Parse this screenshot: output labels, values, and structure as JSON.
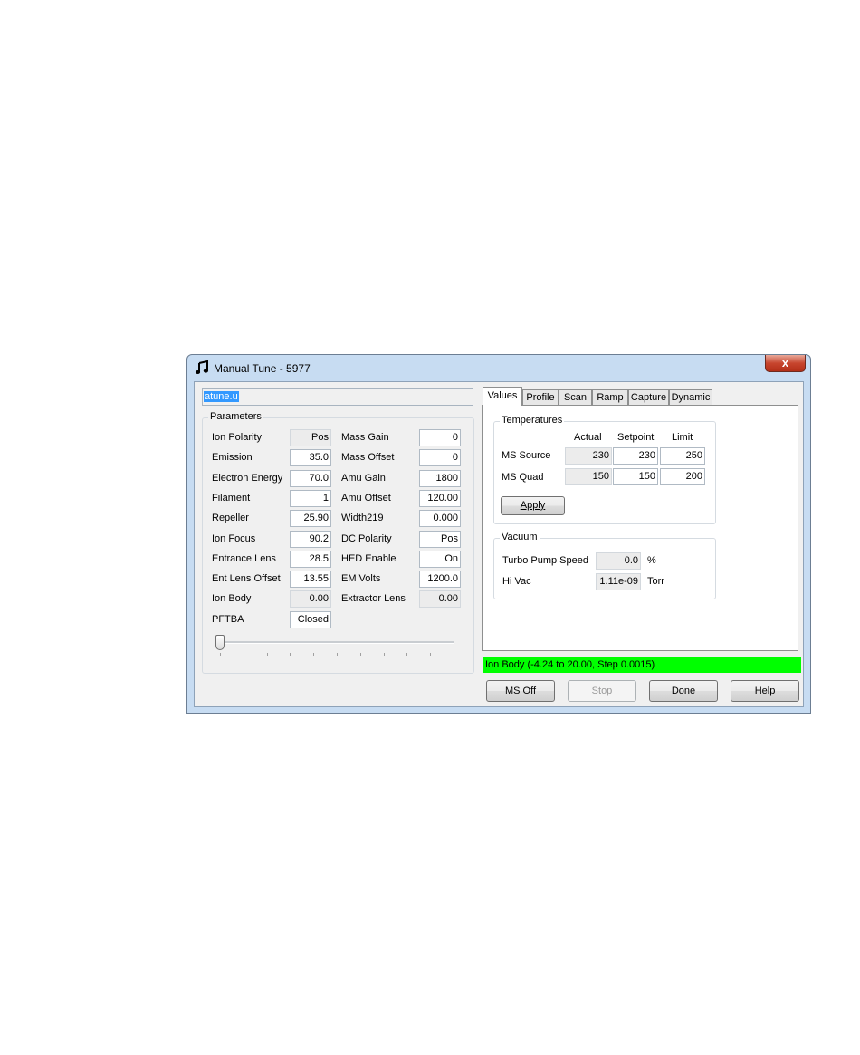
{
  "window": {
    "title": "Manual Tune - 5977",
    "close_glyph": "x"
  },
  "file_name": "atune.u",
  "parameters": {
    "title": "Parameters",
    "left": [
      {
        "label": "Ion Polarity",
        "value": "Pos",
        "readonly": true
      },
      {
        "label": "Emission",
        "value": "35.0",
        "readonly": false
      },
      {
        "label": "Electron Energy",
        "value": "70.0",
        "readonly": false
      },
      {
        "label": "Filament",
        "value": "1",
        "readonly": false
      },
      {
        "label": "Repeller",
        "value": "25.90",
        "readonly": false
      },
      {
        "label": "Ion Focus",
        "value": "90.2",
        "readonly": false
      },
      {
        "label": "Entrance Lens",
        "value": "28.5",
        "readonly": false
      },
      {
        "label": "Ent Lens Offset",
        "value": "13.55",
        "readonly": false
      },
      {
        "label": "Ion Body",
        "value": "0.00",
        "readonly": true
      },
      {
        "label": "PFTBA",
        "value": "Closed",
        "readonly": false
      }
    ],
    "right": [
      {
        "label": "Mass Gain",
        "value": "0",
        "readonly": false
      },
      {
        "label": "Mass Offset",
        "value": "0",
        "readonly": false
      },
      {
        "label": "Amu Gain",
        "value": "1800",
        "readonly": false
      },
      {
        "label": "Amu Offset",
        "value": "120.00",
        "readonly": false
      },
      {
        "label": "Width219",
        "value": "0.000",
        "readonly": false
      },
      {
        "label": "DC Polarity",
        "value": "Pos",
        "readonly": false
      },
      {
        "label": "HED Enable",
        "value": "On",
        "readonly": false
      },
      {
        "label": "EM Volts",
        "value": "1200.0",
        "readonly": false
      },
      {
        "label": "Extractor Lens",
        "value": "0.00",
        "readonly": true
      }
    ],
    "slider_position": 0
  },
  "tabs": [
    "Values",
    "Profile",
    "Scan",
    "Ramp",
    "Capture",
    "Dynamic"
  ],
  "temperatures": {
    "title": "Temperatures",
    "headers": [
      "Actual",
      "Setpoint",
      "Limit"
    ],
    "rows": [
      {
        "label": "MS Source",
        "actual": "230",
        "setpoint": "230",
        "limit": "250"
      },
      {
        "label": "MS Quad",
        "actual": "150",
        "setpoint": "150",
        "limit": "200"
      }
    ],
    "apply_label": "Apply"
  },
  "vacuum": {
    "title": "Vacuum",
    "turbo_label": "Turbo Pump Speed",
    "turbo_value": "0.0",
    "turbo_unit": "%",
    "hivac_label": "Hi Vac",
    "hivac_value": "1.11e-09",
    "hivac_unit": "Torr"
  },
  "status_text": "Ion Body (-4.24 to 20.00, Step 0.0015)",
  "status_color": "#00ff00",
  "buttons": {
    "ms_off": "MS Off",
    "stop": "Stop",
    "done": "Done",
    "help": "Help"
  }
}
